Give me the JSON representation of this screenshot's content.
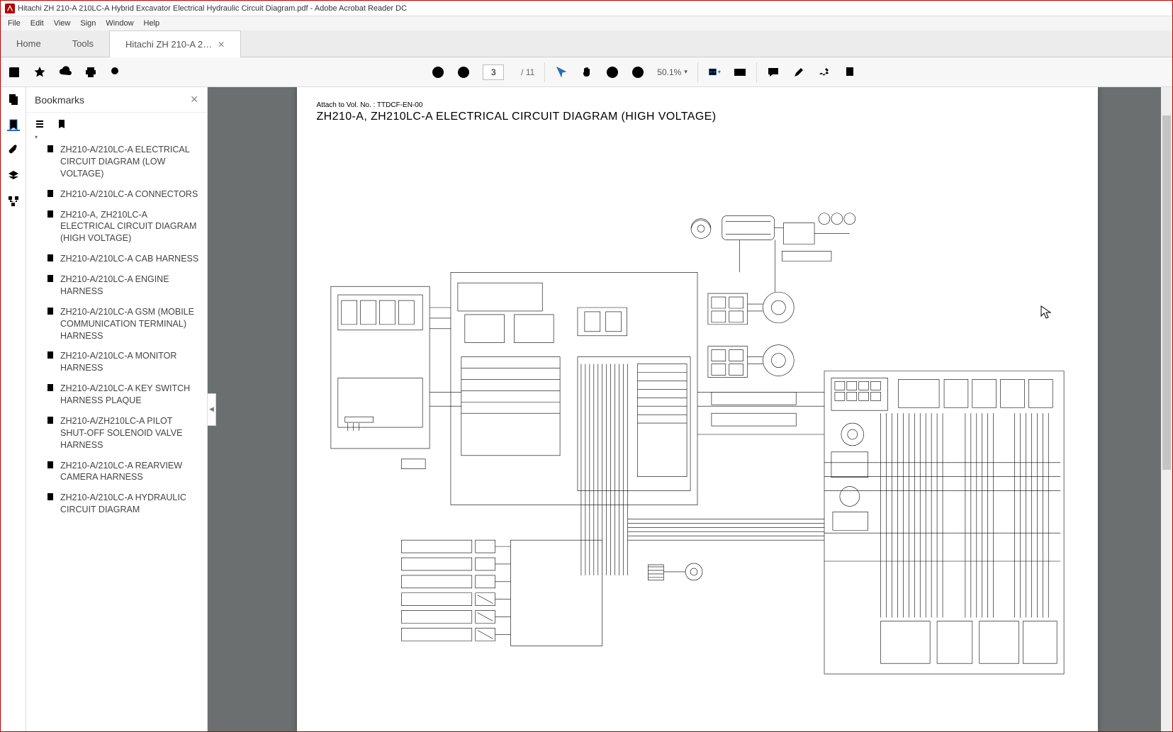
{
  "app": {
    "title": "Hitachi ZH 210-A 210LC-A Hybrid Excavator Electrical Hydraulic Circuit Diagram.pdf - Adobe Acrobat Reader DC"
  },
  "menus": [
    "File",
    "Edit",
    "View",
    "Sign",
    "Window",
    "Help"
  ],
  "tabs": {
    "home": "Home",
    "tools": "Tools",
    "doc": "Hitachi ZH 210-A 2…"
  },
  "toolbar": {
    "page_current": "3",
    "page_total": "/ 11",
    "zoom": "50.1%"
  },
  "panel": {
    "title": "Bookmarks"
  },
  "bookmarks": [
    "ZH210-A/210LC-A ELECTRICAL CIRCUIT DIAGRAM (LOW VOLTAGE)",
    "ZH210-A/210LC-A CONNECTORS",
    "ZH210-A, ZH210LC-A ELECTRICAL CIRCUIT DIAGRAM (HIGH VOLTAGE)",
    "ZH210-A/210LC-A CAB HARNESS",
    "ZH210-A/210LC-A ENGINE HARNESS",
    "ZH210-A/210LC-A GSM (MOBILE COMMUNICATION TERMINAL) HARNESS",
    "ZH210-A/210LC-A MONITOR HARNESS",
    "ZH210-A/210LC-A KEY SWITCH HARNESS PLAQUE",
    "ZH210-A/ZH210LC-A PILOT SHUT-OFF SOLENOID VALVE HARNESS",
    "ZH210-A/210LC-A REARVIEW CAMERA HARNESS",
    "ZH210-A/210LC-A HYDRAULIC CIRCUIT DIAGRAM"
  ],
  "page": {
    "attach": "Attach to Vol. No. : TTDCF-EN-00",
    "title": "ZH210-A, ZH210LC-A ELECTRICAL CIRCUIT DIAGRAM (HIGH VOLTAGE)"
  }
}
